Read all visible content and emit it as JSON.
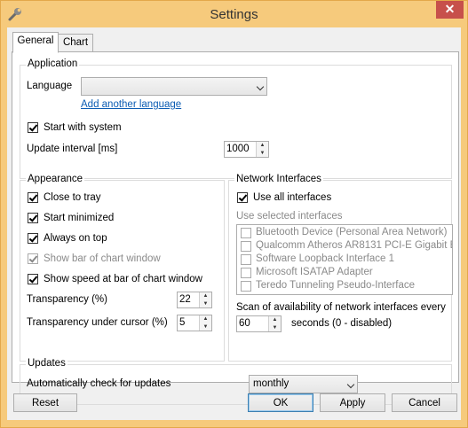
{
  "window": {
    "title": "Settings",
    "close_glyph": "✕"
  },
  "tabs": [
    {
      "label": "General"
    },
    {
      "label": "Chart"
    }
  ],
  "application": {
    "group_title": "Application",
    "language_label": "Language",
    "language_value": "",
    "add_language_link": "Add another language",
    "start_with_system": {
      "label": "Start with system",
      "checked": true
    },
    "update_interval_label": "Update interval [ms]",
    "update_interval_value": "1000"
  },
  "appearance": {
    "group_title": "Appearance",
    "options": [
      {
        "label": "Close to tray",
        "checked": true,
        "enabled": true
      },
      {
        "label": "Start minimized",
        "checked": true,
        "enabled": true
      },
      {
        "label": "Always on top",
        "checked": true,
        "enabled": true
      },
      {
        "label": "Show bar of chart window",
        "checked": true,
        "enabled": false
      },
      {
        "label": "Show speed at bar of chart window",
        "checked": true,
        "enabled": true
      }
    ],
    "transparency_label": "Transparency (%)",
    "transparency_value": "22",
    "transparency_cursor_label": "Transparency under cursor (%)",
    "transparency_cursor_value": "5"
  },
  "network": {
    "group_title": "Network Interfaces",
    "use_all": {
      "label": "Use all interfaces",
      "checked": true
    },
    "use_selected_label": "Use selected interfaces",
    "interfaces": [
      "Bluetooth Device (Personal Area Network)",
      "Qualcomm Atheros AR8131 PCI-E Gigabit Ethe",
      "Software Loopback Interface 1",
      "Microsoft ISATAP Adapter",
      "Teredo Tunneling Pseudo-Interface"
    ],
    "scan_label": "Scan of availability of network interfaces every",
    "scan_value": "60",
    "scan_suffix": "seconds (0 - disabled)"
  },
  "updates": {
    "group_title": "Updates",
    "auto_check_label": "Automatically check for updates",
    "frequency_value": "monthly"
  },
  "buttons": {
    "reset": "Reset",
    "ok": "OK",
    "apply": "Apply",
    "cancel": "Cancel"
  },
  "colors": {
    "title_bar": "#f6ca7c",
    "close_button": "#c7504b",
    "link": "#0b5cb3"
  }
}
